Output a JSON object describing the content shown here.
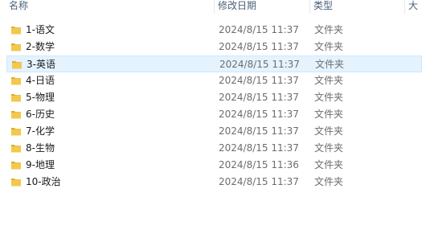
{
  "columns": {
    "name": "名称",
    "date": "修改日期",
    "type": "类型",
    "size": "大"
  },
  "rows": [
    {
      "name": "1-语文",
      "date": "2024/8/15 11:37",
      "type": "文件夹",
      "selected": false
    },
    {
      "name": "2-数学",
      "date": "2024/8/15 11:37",
      "type": "文件夹",
      "selected": false
    },
    {
      "name": "3-英语",
      "date": "2024/8/15 11:37",
      "type": "文件夹",
      "selected": true
    },
    {
      "name": "4-日语",
      "date": "2024/8/15 11:37",
      "type": "文件夹",
      "selected": false
    },
    {
      "name": "5-物理",
      "date": "2024/8/15 11:37",
      "type": "文件夹",
      "selected": false
    },
    {
      "name": "6-历史",
      "date": "2024/8/15 11:37",
      "type": "文件夹",
      "selected": false
    },
    {
      "name": "7-化学",
      "date": "2024/8/15 11:37",
      "type": "文件夹",
      "selected": false
    },
    {
      "name": "8-生物",
      "date": "2024/8/15 11:37",
      "type": "文件夹",
      "selected": false
    },
    {
      "name": "9-地理",
      "date": "2024/8/15 11:36",
      "type": "文件夹",
      "selected": false
    },
    {
      "name": "10-政治",
      "date": "2024/8/15 11:37",
      "type": "文件夹",
      "selected": false
    }
  ],
  "icon": "folder-icon",
  "colors": {
    "folder_body": "#f2c94c",
    "folder_tab": "#dcae2f",
    "selection_bg": "#e5f3ff",
    "selection_border": "#cce8ff",
    "header_text": "#4c607a"
  }
}
